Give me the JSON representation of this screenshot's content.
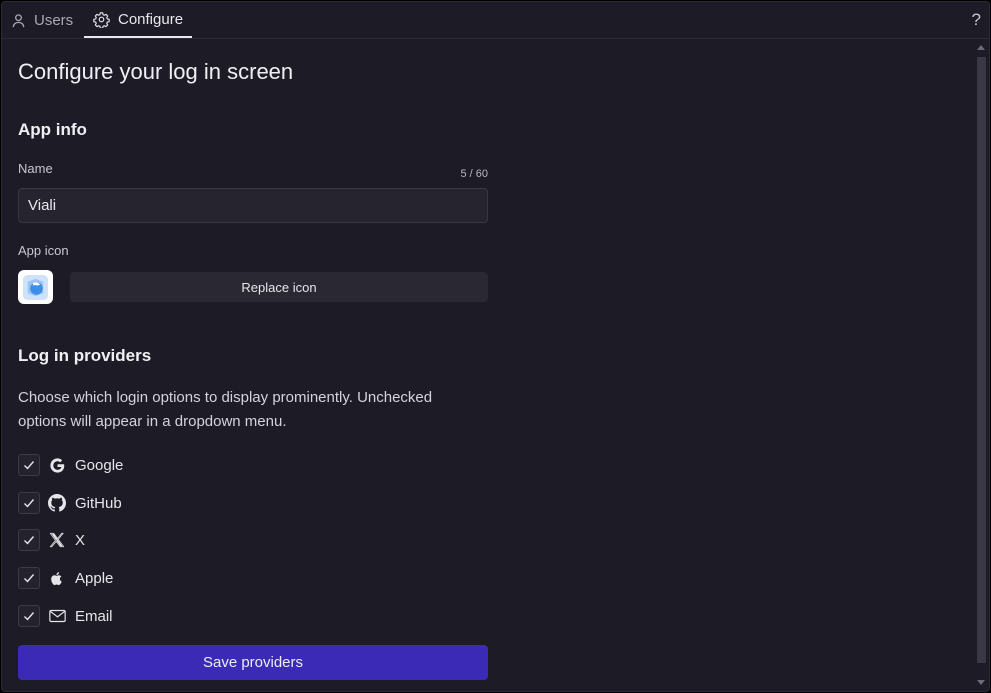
{
  "tabs": {
    "users": "Users",
    "configure": "Configure",
    "help": "?"
  },
  "page": {
    "title": "Configure your log in screen"
  },
  "app_info": {
    "title": "App info",
    "name_label": "Name",
    "name_counter": "5 / 60",
    "name_value": "Viali",
    "icon_label": "App icon",
    "replace_icon": "Replace icon"
  },
  "providers": {
    "title": "Log in providers",
    "description": "Choose which login options to display prominently. Unchecked options will appear in a dropdown menu.",
    "items": [
      {
        "label": "Google",
        "icon": "google-icon",
        "checked": true
      },
      {
        "label": "GitHub",
        "icon": "github-icon",
        "checked": true
      },
      {
        "label": "X",
        "icon": "x-icon",
        "checked": true
      },
      {
        "label": "Apple",
        "icon": "apple-icon",
        "checked": true
      },
      {
        "label": "Email",
        "icon": "email-icon",
        "checked": true
      }
    ],
    "save": "Save providers"
  },
  "colors": {
    "background": "#1d1b25",
    "accent": "#3a2ab5"
  }
}
